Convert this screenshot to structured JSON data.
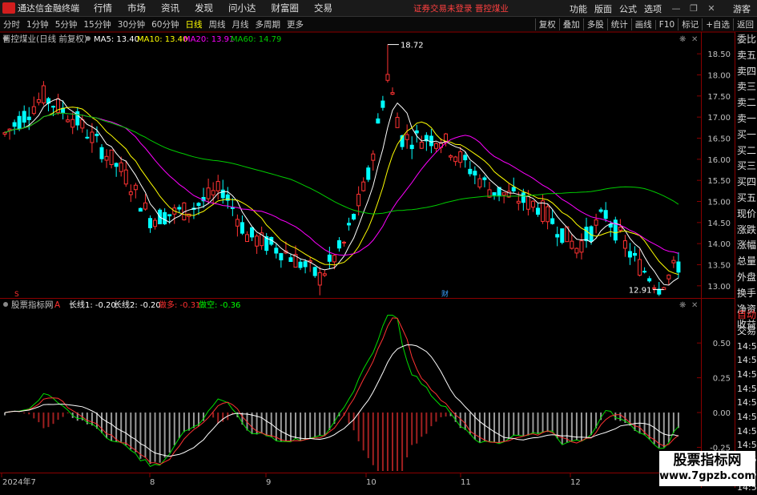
{
  "menubar": {
    "app_title": "通达信金融终端",
    "items": [
      "行情",
      "市场",
      "资讯",
      "发现",
      "问小达",
      "财富圈",
      "交易"
    ],
    "notice": "证券交易未登录  晋控煤业",
    "right_items": [
      "功能",
      "版面",
      "公式",
      "选项"
    ],
    "guest": "游客"
  },
  "periodbar": {
    "periods": [
      "分时",
      "1分钟",
      "5分钟",
      "15分钟",
      "30分钟",
      "60分钟",
      "日线",
      "周线",
      "月线",
      "多周期",
      "更多"
    ],
    "active": "日线",
    "tools": [
      "复权",
      "叠加",
      "多股",
      "统计",
      "画线",
      "F10",
      "标记",
      "+自选",
      "返回"
    ]
  },
  "main_chart": {
    "stock_name": "晋控煤业(日线 前复权)",
    "ma": [
      {
        "label": "MA5: 13.40",
        "color": "#ffffff"
      },
      {
        "label": "MA10: 13.40",
        "color": "#ffff00"
      },
      {
        "label": "MA20: 13.91",
        "color": "#ff00ff"
      },
      {
        "label": "MA60: 14.79",
        "color": "#00cc00"
      }
    ],
    "high_label": "18.72",
    "low_label": "12.91",
    "y_ticks": [
      "18.50",
      "18.00",
      "17.50",
      "17.00",
      "16.50",
      "16.00",
      "15.50",
      "15.00",
      "14.50",
      "14.00",
      "13.50",
      "13.00"
    ],
    "y_range": [
      12.75,
      18.75
    ],
    "event_marker": "财",
    "s_marker": "S"
  },
  "indicator": {
    "name": "股票指标网",
    "mode": "A",
    "values": [
      {
        "label": "长线1: -0.20",
        "color": "#ffffff"
      },
      {
        "label": "长线2: -0.20",
        "color": "#ffffff"
      },
      {
        "label": "做多: -0.31",
        "color": "#ff3030"
      },
      {
        "label": "做空: -0.36",
        "color": "#00ff00"
      }
    ],
    "y_ticks": [
      "0.50",
      "0.25",
      "0.00",
      "-0.25"
    ],
    "y_range": [
      -0.42,
      0.72
    ]
  },
  "x_axis": {
    "labels": [
      "2024年7",
      "8",
      "9",
      "10",
      "11",
      "12"
    ]
  },
  "right_panel": {
    "items": [
      "委比",
      "卖五",
      "卖四",
      "卖三",
      "卖二",
      "卖一",
      "买一",
      "买二",
      "买三",
      "买四",
      "买五",
      "现价",
      "涨跌",
      "涨幅",
      "总量",
      "外盘",
      "换手",
      "净资",
      "收益"
    ],
    "lower": [
      "自动",
      "交易"
    ],
    "times": [
      "14:56",
      "14:56",
      "14:56",
      "14:56",
      "14:56",
      "14:56",
      "14:56",
      "14:56",
      "14:56",
      "14:56",
      "14:56"
    ]
  },
  "watermark": {
    "line1": "股票指标网",
    "line2": "www.7gpzb.com"
  },
  "colors": {
    "up": "#ff3232",
    "down": "#00ffff",
    "ma5": "#ffffff",
    "ma10": "#ffff00",
    "ma20": "#ff00ff",
    "ma60": "#00cc00",
    "grid_axis": "#8b0000",
    "tick_text": "#c0c0c0"
  }
}
